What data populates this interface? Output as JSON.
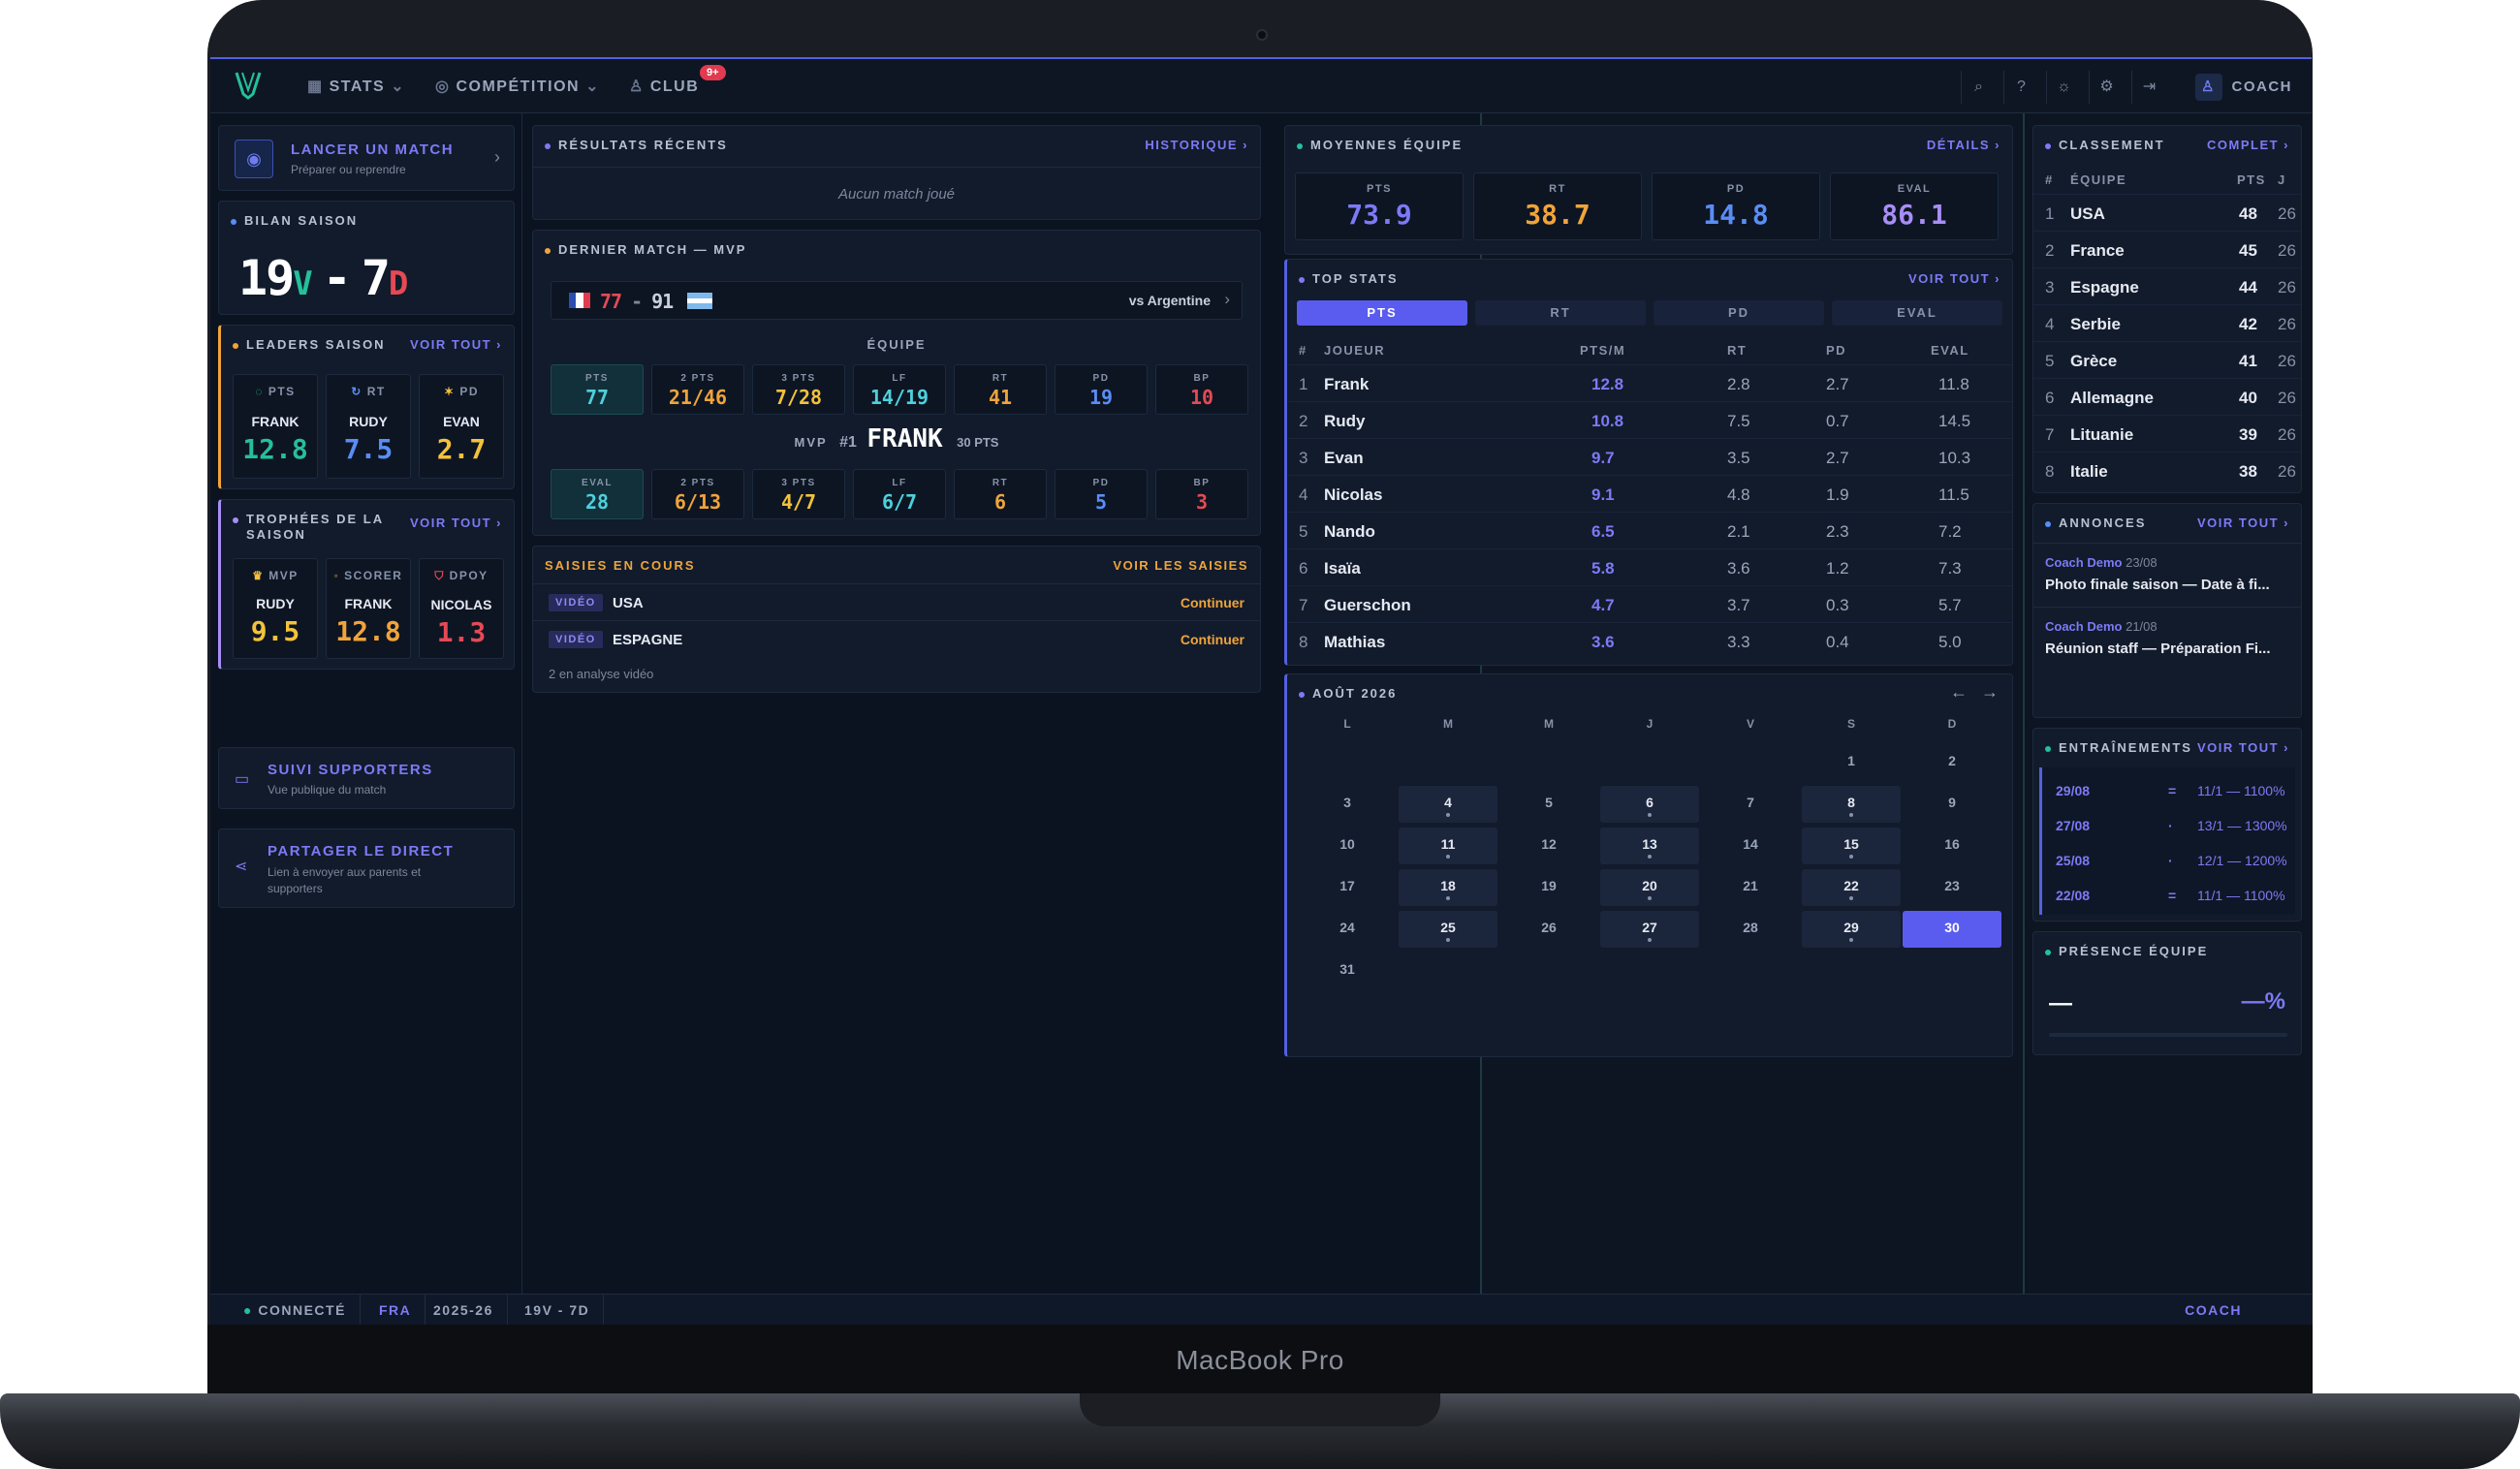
{
  "device": {
    "label": "MacBook Pro"
  },
  "topbar": {
    "nav": [
      {
        "label": "STATS",
        "icon": "chart-icon"
      },
      {
        "label": "COMPÉTITION",
        "icon": "trophy-icon"
      },
      {
        "label": "CLUB",
        "icon": "people-icon"
      }
    ],
    "club_badge": "9+",
    "user_label": "COACH"
  },
  "left": {
    "launch": {
      "title": "LANCER UN MATCH",
      "subtitle": "Préparer ou reprendre"
    },
    "season": {
      "title": "BILAN SAISON",
      "wins": "19",
      "wins_suffix": "V",
      "sep": "-",
      "losses": "7",
      "losses_suffix": "D"
    },
    "leaders": {
      "title": "LEADERS SAISON",
      "link": "VOIR TOUT ›",
      "items": [
        {
          "label": "PTS",
          "name": "FRANK",
          "value": "12.8",
          "color": "#25c09a"
        },
        {
          "label": "RT",
          "name": "RUDY",
          "value": "7.5",
          "color": "#5a8df5"
        },
        {
          "label": "PD",
          "name": "EVAN",
          "value": "2.7",
          "color": "#f3c23b"
        }
      ]
    },
    "trophies": {
      "title_line1": "TROPHÉES DE LA",
      "title_line2": "SAISON",
      "link": "VOIR TOUT ›",
      "items": [
        {
          "label": "MVP",
          "name": "RUDY",
          "value": "9.5",
          "color": "#f3c23b"
        },
        {
          "label": "SCORER",
          "name": "FRANK",
          "value": "12.8",
          "color": "#f0a43a"
        },
        {
          "label": "DPOY",
          "name": "NICOLAS",
          "value": "1.3",
          "color": "#e44a54"
        }
      ]
    },
    "supporters": {
      "title": "SUIVI SUPPORTERS",
      "subtitle": "Vue publique du match"
    },
    "share": {
      "title": "PARTAGER LE DIRECT",
      "subtitle_line1": "Lien à envoyer aux parents et",
      "subtitle_line2": "supporters"
    }
  },
  "middle": {
    "recent": {
      "title": "RÉSULTATS RÉCENTS",
      "link": "HISTORIQUE ›",
      "empty": "Aucun match joué"
    },
    "last_match": {
      "title": "DERNIER MATCH — MVP",
      "score_home": "77",
      "score_sep": "-",
      "score_away": "91",
      "opponent": "vs Argentine",
      "team_label": "ÉQUIPE",
      "team_stats": [
        {
          "label": "PTS",
          "value": "77",
          "color": "#4fd0dc"
        },
        {
          "label": "2 PTS",
          "value": "21/46",
          "color": "#f0a43a"
        },
        {
          "label": "3 PTS",
          "value": "7/28",
          "color": "#f3c23b"
        },
        {
          "label": "LF",
          "value": "14/19",
          "color": "#4fd0dc"
        },
        {
          "label": "RT",
          "value": "41",
          "color": "#f0a43a"
        },
        {
          "label": "PD",
          "value": "19",
          "color": "#5a8df5"
        },
        {
          "label": "BP",
          "value": "10",
          "color": "#e44a54"
        }
      ],
      "mvp_label": "MVP",
      "mvp_rank": "#1",
      "mvp_name": "FRANK",
      "mvp_pts": "30 PTS",
      "mvp_stats": [
        {
          "label": "EVAL",
          "value": "28",
          "color": "#4fd0dc"
        },
        {
          "label": "2 PTS",
          "value": "6/13",
          "color": "#f0a43a"
        },
        {
          "label": "3 PTS",
          "value": "4/7",
          "color": "#f3c23b"
        },
        {
          "label": "LF",
          "value": "6/7",
          "color": "#4fd0dc"
        },
        {
          "label": "RT",
          "value": "6",
          "color": "#f0a43a"
        },
        {
          "label": "PD",
          "value": "5",
          "color": "#5a8df5"
        },
        {
          "label": "BP",
          "value": "3",
          "color": "#e44a54"
        }
      ]
    },
    "inputs": {
      "title": "SAISIES EN COURS",
      "link": "VOIR LES SAISIES",
      "items": [
        {
          "tag": "VIDÉO",
          "team": "USA",
          "action": "Continuer"
        },
        {
          "tag": "VIDÉO",
          "team": "ESPAGNE",
          "action": "Continuer"
        }
      ],
      "footer": "2 en analyse vidéo"
    }
  },
  "right": {
    "averages": {
      "title": "MOYENNES ÉQUIPE",
      "link": "DÉTAILS ›",
      "items": [
        {
          "label": "PTS",
          "value": "73.9",
          "color": "#7d7af5"
        },
        {
          "label": "RT",
          "value": "38.7",
          "color": "#f0a43a"
        },
        {
          "label": "PD",
          "value": "14.8",
          "color": "#5a8df5"
        },
        {
          "label": "EVAL",
          "value": "86.1",
          "color": "#a88df5"
        }
      ]
    },
    "top": {
      "title": "TOP STATS",
      "link": "VOIR TOUT ›",
      "tabs": [
        "PTS",
        "RT",
        "PD",
        "EVAL"
      ],
      "headers": [
        "#",
        "JOUEUR",
        "PTS/M",
        "RT",
        "PD",
        "EVAL"
      ],
      "rows": [
        [
          "1",
          "Frank",
          "12.8",
          "2.8",
          "2.7",
          "11.8"
        ],
        [
          "2",
          "Rudy",
          "10.8",
          "7.5",
          "0.7",
          "14.5"
        ],
        [
          "3",
          "Evan",
          "9.7",
          "3.5",
          "2.7",
          "10.3"
        ],
        [
          "4",
          "Nicolas",
          "9.1",
          "4.8",
          "1.9",
          "11.5"
        ],
        [
          "5",
          "Nando",
          "6.5",
          "2.1",
          "2.3",
          "7.2"
        ],
        [
          "6",
          "Isaïa",
          "5.8",
          "3.6",
          "1.2",
          "7.3"
        ],
        [
          "7",
          "Guerschon",
          "4.7",
          "3.7",
          "0.3",
          "5.7"
        ],
        [
          "8",
          "Mathias",
          "3.6",
          "3.3",
          "0.4",
          "5.0"
        ]
      ]
    },
    "calendar": {
      "title": "AOÛT 2026",
      "weekdays": [
        "L",
        "M",
        "M",
        "J",
        "V",
        "S",
        "D"
      ],
      "weeks": [
        [
          "",
          "",
          "",
          "",
          "",
          "1",
          "2"
        ],
        [
          "3",
          "4",
          "5",
          "6",
          "7",
          "8",
          "9"
        ],
        [
          "10",
          "11",
          "12",
          "13",
          "14",
          "15",
          "16"
        ],
        [
          "17",
          "18",
          "19",
          "20",
          "21",
          "22",
          "23"
        ],
        [
          "24",
          "25",
          "26",
          "27",
          "28",
          "29",
          "30"
        ],
        [
          "31",
          "",
          "",
          "",
          "",
          "",
          ""
        ]
      ],
      "event_days": [
        "4",
        "6",
        "8",
        "11",
        "13",
        "15",
        "18",
        "20",
        "22",
        "25",
        "27",
        "29"
      ],
      "today": "30"
    }
  },
  "far_right": {
    "ranking": {
      "title": "CLASSEMENT",
      "link": "COMPLET ›",
      "headers": [
        "#",
        "ÉQUIPE",
        "PTS",
        "J"
      ],
      "rows": [
        [
          "1",
          "USA",
          "48",
          "26"
        ],
        [
          "2",
          "France",
          "45",
          "26"
        ],
        [
          "3",
          "Espagne",
          "44",
          "26"
        ],
        [
          "4",
          "Serbie",
          "42",
          "26"
        ],
        [
          "5",
          "Grèce",
          "41",
          "26"
        ],
        [
          "6",
          "Allemagne",
          "40",
          "26"
        ],
        [
          "7",
          "Lituanie",
          "39",
          "26"
        ],
        [
          "8",
          "Italie",
          "38",
          "26"
        ]
      ]
    },
    "announcements": {
      "title": "ANNONCES",
      "link": "VOIR TOUT ›",
      "items": [
        {
          "author": "Coach Demo",
          "date": "23/08",
          "text": "Photo finale saison — Date à fi..."
        },
        {
          "author": "Coach Demo",
          "date": "21/08",
          "text": "Réunion staff — Préparation Fi..."
        }
      ]
    },
    "trainings": {
      "title": "ENTRAÎNEMENTS",
      "link": "VOIR TOUT ›",
      "items": [
        {
          "date": "29/08",
          "sep": "=",
          "detail": "11/1 — 1100%"
        },
        {
          "date": "27/08",
          "sep": "·",
          "detail": "13/1 — 1300%"
        },
        {
          "date": "25/08",
          "sep": "·",
          "detail": "12/1 — 1200%"
        },
        {
          "date": "22/08",
          "sep": "=",
          "detail": "11/1 — 1100%"
        }
      ]
    },
    "presence": {
      "title": "PRÉSENCE ÉQUIPE",
      "value": "—",
      "percent": "—%"
    }
  },
  "status": {
    "connected": "CONNECTÉ",
    "lang": "FRA",
    "season": "2025-26",
    "record": "19V - 7D",
    "role": "COACH"
  }
}
